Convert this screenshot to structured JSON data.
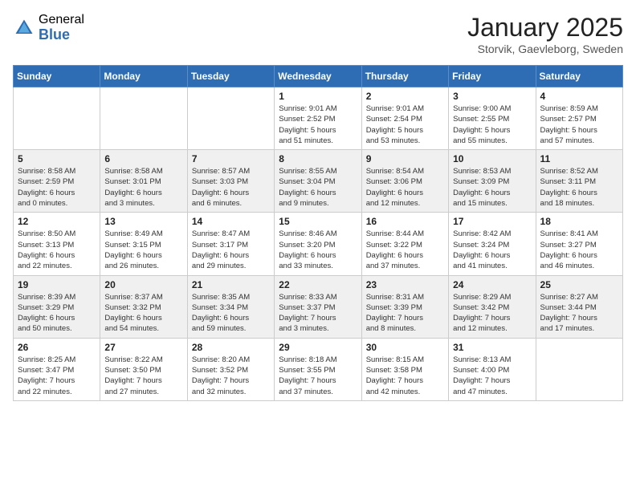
{
  "header": {
    "logo_general": "General",
    "logo_blue": "Blue",
    "month_title": "January 2025",
    "location": "Storvik, Gaevleborg, Sweden"
  },
  "days_of_week": [
    "Sunday",
    "Monday",
    "Tuesday",
    "Wednesday",
    "Thursday",
    "Friday",
    "Saturday"
  ],
  "weeks": [
    [
      {
        "day": "",
        "info": ""
      },
      {
        "day": "",
        "info": ""
      },
      {
        "day": "",
        "info": ""
      },
      {
        "day": "1",
        "info": "Sunrise: 9:01 AM\nSunset: 2:52 PM\nDaylight: 5 hours\nand 51 minutes."
      },
      {
        "day": "2",
        "info": "Sunrise: 9:01 AM\nSunset: 2:54 PM\nDaylight: 5 hours\nand 53 minutes."
      },
      {
        "day": "3",
        "info": "Sunrise: 9:00 AM\nSunset: 2:55 PM\nDaylight: 5 hours\nand 55 minutes."
      },
      {
        "day": "4",
        "info": "Sunrise: 8:59 AM\nSunset: 2:57 PM\nDaylight: 5 hours\nand 57 minutes."
      }
    ],
    [
      {
        "day": "5",
        "info": "Sunrise: 8:58 AM\nSunset: 2:59 PM\nDaylight: 6 hours\nand 0 minutes."
      },
      {
        "day": "6",
        "info": "Sunrise: 8:58 AM\nSunset: 3:01 PM\nDaylight: 6 hours\nand 3 minutes."
      },
      {
        "day": "7",
        "info": "Sunrise: 8:57 AM\nSunset: 3:03 PM\nDaylight: 6 hours\nand 6 minutes."
      },
      {
        "day": "8",
        "info": "Sunrise: 8:55 AM\nSunset: 3:04 PM\nDaylight: 6 hours\nand 9 minutes."
      },
      {
        "day": "9",
        "info": "Sunrise: 8:54 AM\nSunset: 3:06 PM\nDaylight: 6 hours\nand 12 minutes."
      },
      {
        "day": "10",
        "info": "Sunrise: 8:53 AM\nSunset: 3:09 PM\nDaylight: 6 hours\nand 15 minutes."
      },
      {
        "day": "11",
        "info": "Sunrise: 8:52 AM\nSunset: 3:11 PM\nDaylight: 6 hours\nand 18 minutes."
      }
    ],
    [
      {
        "day": "12",
        "info": "Sunrise: 8:50 AM\nSunset: 3:13 PM\nDaylight: 6 hours\nand 22 minutes."
      },
      {
        "day": "13",
        "info": "Sunrise: 8:49 AM\nSunset: 3:15 PM\nDaylight: 6 hours\nand 26 minutes."
      },
      {
        "day": "14",
        "info": "Sunrise: 8:47 AM\nSunset: 3:17 PM\nDaylight: 6 hours\nand 29 minutes."
      },
      {
        "day": "15",
        "info": "Sunrise: 8:46 AM\nSunset: 3:20 PM\nDaylight: 6 hours\nand 33 minutes."
      },
      {
        "day": "16",
        "info": "Sunrise: 8:44 AM\nSunset: 3:22 PM\nDaylight: 6 hours\nand 37 minutes."
      },
      {
        "day": "17",
        "info": "Sunrise: 8:42 AM\nSunset: 3:24 PM\nDaylight: 6 hours\nand 41 minutes."
      },
      {
        "day": "18",
        "info": "Sunrise: 8:41 AM\nSunset: 3:27 PM\nDaylight: 6 hours\nand 46 minutes."
      }
    ],
    [
      {
        "day": "19",
        "info": "Sunrise: 8:39 AM\nSunset: 3:29 PM\nDaylight: 6 hours\nand 50 minutes."
      },
      {
        "day": "20",
        "info": "Sunrise: 8:37 AM\nSunset: 3:32 PM\nDaylight: 6 hours\nand 54 minutes."
      },
      {
        "day": "21",
        "info": "Sunrise: 8:35 AM\nSunset: 3:34 PM\nDaylight: 6 hours\nand 59 minutes."
      },
      {
        "day": "22",
        "info": "Sunrise: 8:33 AM\nSunset: 3:37 PM\nDaylight: 7 hours\nand 3 minutes."
      },
      {
        "day": "23",
        "info": "Sunrise: 8:31 AM\nSunset: 3:39 PM\nDaylight: 7 hours\nand 8 minutes."
      },
      {
        "day": "24",
        "info": "Sunrise: 8:29 AM\nSunset: 3:42 PM\nDaylight: 7 hours\nand 12 minutes."
      },
      {
        "day": "25",
        "info": "Sunrise: 8:27 AM\nSunset: 3:44 PM\nDaylight: 7 hours\nand 17 minutes."
      }
    ],
    [
      {
        "day": "26",
        "info": "Sunrise: 8:25 AM\nSunset: 3:47 PM\nDaylight: 7 hours\nand 22 minutes."
      },
      {
        "day": "27",
        "info": "Sunrise: 8:22 AM\nSunset: 3:50 PM\nDaylight: 7 hours\nand 27 minutes."
      },
      {
        "day": "28",
        "info": "Sunrise: 8:20 AM\nSunset: 3:52 PM\nDaylight: 7 hours\nand 32 minutes."
      },
      {
        "day": "29",
        "info": "Sunrise: 8:18 AM\nSunset: 3:55 PM\nDaylight: 7 hours\nand 37 minutes."
      },
      {
        "day": "30",
        "info": "Sunrise: 8:15 AM\nSunset: 3:58 PM\nDaylight: 7 hours\nand 42 minutes."
      },
      {
        "day": "31",
        "info": "Sunrise: 8:13 AM\nSunset: 4:00 PM\nDaylight: 7 hours\nand 47 minutes."
      },
      {
        "day": "",
        "info": ""
      }
    ]
  ]
}
